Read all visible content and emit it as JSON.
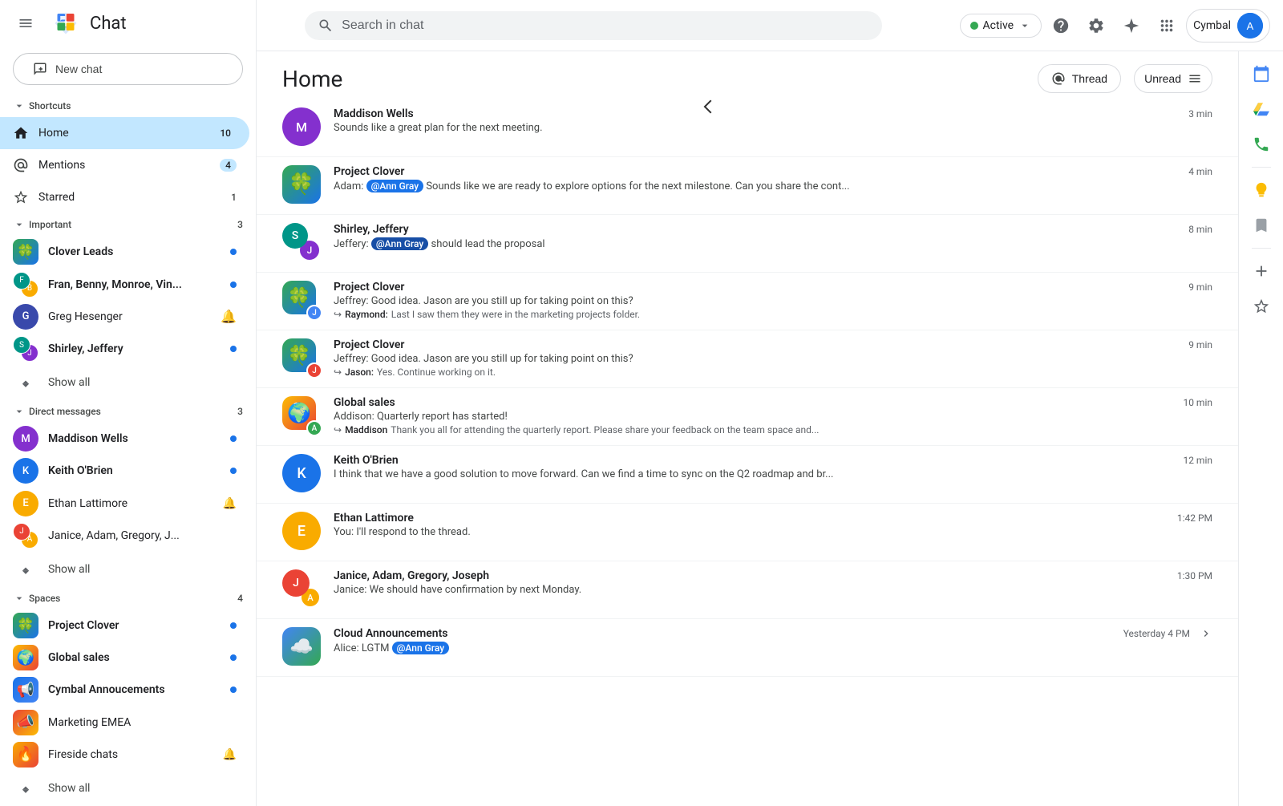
{
  "app": {
    "title": "Chat",
    "logo_emoji": "💬"
  },
  "topbar": {
    "search_placeholder": "Search in chat",
    "status_label": "Active",
    "help_icon": "?",
    "settings_icon": "⚙",
    "spark_icon": "✦",
    "grid_icon": "⊞",
    "account_label": "Cymbal"
  },
  "new_chat_label": "New chat",
  "sidebar": {
    "shortcuts_label": "Shortcuts",
    "shortcuts_badge": "",
    "items_shortcuts": [
      {
        "id": "home",
        "label": "Home",
        "active": true,
        "badge": "10",
        "icon": "🏠"
      },
      {
        "id": "mentions",
        "label": "Mentions",
        "active": false,
        "badge": "4",
        "icon": "@"
      },
      {
        "id": "starred",
        "label": "Starred",
        "active": false,
        "badge": "1",
        "icon": "☆"
      }
    ],
    "important_label": "Important",
    "important_badge": "3",
    "items_important": [
      {
        "id": "clover-leads",
        "label": "Clover Leads",
        "unread_dot": true
      },
      {
        "id": "fran-benny",
        "label": "Fran, Benny, Monroe, Vin...",
        "unread_dot": true
      },
      {
        "id": "greg-hesenger",
        "label": "Greg Hesenger",
        "bell": true
      },
      {
        "id": "shirley-jeffery",
        "label": "Shirley, Jeffery",
        "unread_dot": true
      }
    ],
    "show_all_important": "Show all",
    "direct_messages_label": "Direct messages",
    "direct_messages_badge": "3",
    "items_dm": [
      {
        "id": "maddison-wells",
        "label": "Maddison Wells",
        "unread_dot": true
      },
      {
        "id": "keith-obrien",
        "label": "Keith O'Brien",
        "unread_dot": true
      },
      {
        "id": "ethan-lattimore",
        "label": "Ethan Lattimore",
        "bell": true
      },
      {
        "id": "janice-adam",
        "label": "Janice, Adam, Gregory, J...",
        "unread_dot": false
      }
    ],
    "show_all_dm": "Show all",
    "spaces_label": "Spaces",
    "spaces_badge": "4",
    "items_spaces": [
      {
        "id": "project-clover",
        "label": "Project Clover",
        "unread_dot": true,
        "emoji": "🍀"
      },
      {
        "id": "global-sales",
        "label": "Global sales",
        "unread_dot": true,
        "emoji": "🌍"
      },
      {
        "id": "cymbal-announcements",
        "label": "Cymbal Annoucements",
        "unread_dot": true,
        "emoji": "📢"
      },
      {
        "id": "marketing-emea",
        "label": "Marketing EMEA",
        "unread_dot": false,
        "emoji": "📣"
      },
      {
        "id": "fireside-chats",
        "label": "Fireside chats",
        "bell": true,
        "emoji": "🔥"
      }
    ],
    "show_all_spaces": "Show all"
  },
  "main": {
    "title": "Home",
    "thread_btn": "Thread",
    "unread_btn": "Unread",
    "messages": [
      {
        "id": "msg1",
        "name": "Maddison Wells",
        "time": "3 min",
        "message": "Sounds like a great plan for the next meeting.",
        "avatar_color": "av-purple",
        "avatar_letter": "M"
      },
      {
        "id": "msg2",
        "name": "Project Clover",
        "time": "4 min",
        "message_prefix": "Adam:",
        "mention": "@Ann Gray",
        "message_suffix": "Sounds like we are ready to explore options for the next milestone. Can you share the cont...",
        "is_space": true,
        "emoji": "🍀"
      },
      {
        "id": "msg3",
        "name": "Shirley, Jeffery",
        "time": "8 min",
        "message_prefix": "Jeffery:",
        "mention": "@Ann Gray",
        "message_suffix": "should lead the proposal",
        "avatar_color": "av-teal",
        "avatar_letter": "S",
        "is_group": true
      },
      {
        "id": "msg4",
        "name": "Project Clover",
        "time": "9 min",
        "message": "Jeffrey: Good idea. Jason are you still up for taking point on this?",
        "reply": "Raymond: Last I saw them they were in the marketing projects folder.",
        "is_space": true,
        "emoji": "🍀"
      },
      {
        "id": "msg5",
        "name": "Project Clover",
        "time": "9 min",
        "message": "Jeffrey: Good idea. Jason are you still up for taking point on this?",
        "reply": "Jason: Yes. Continue working on it.",
        "is_space": true,
        "emoji": "🍀"
      },
      {
        "id": "msg6",
        "name": "Global sales",
        "time": "10 min",
        "message": "Addison: Quarterly report has started!",
        "reply": "Maddison Thank you all for attending the quarterly report. Please share your feedback on the team space and...",
        "is_space": true,
        "emoji": "🌍"
      },
      {
        "id": "msg7",
        "name": "Keith O'Brien",
        "time": "12 min",
        "message": "I think that we have a good solution to move forward. Can we find a time to sync on the Q2 roadmap and br...",
        "avatar_color": "av-blue",
        "avatar_letter": "K"
      },
      {
        "id": "msg8",
        "name": "Ethan Lattimore",
        "time": "1:42 PM",
        "message": "You: I'll respond to the thread.",
        "avatar_color": "av-orange",
        "avatar_letter": "E"
      },
      {
        "id": "msg9",
        "name": "Janice, Adam, Gregory, Joseph",
        "time": "1:30 PM",
        "message": "Janice: We should have confirmation by next Monday.",
        "is_group": true,
        "avatar_color": "av-red",
        "avatar_letter": "J"
      },
      {
        "id": "msg10",
        "name": "Cloud Announcements",
        "time": "Yesterday 4 PM",
        "message_prefix": "Alice: LGTM",
        "mention": "@Ann Gray",
        "message_suffix": "",
        "is_space": true,
        "emoji": "☁️"
      }
    ]
  },
  "right_sidebar": {
    "icons": [
      "calendar",
      "drive",
      "phone",
      "tasks",
      "bookmark",
      "add",
      "starred"
    ]
  }
}
